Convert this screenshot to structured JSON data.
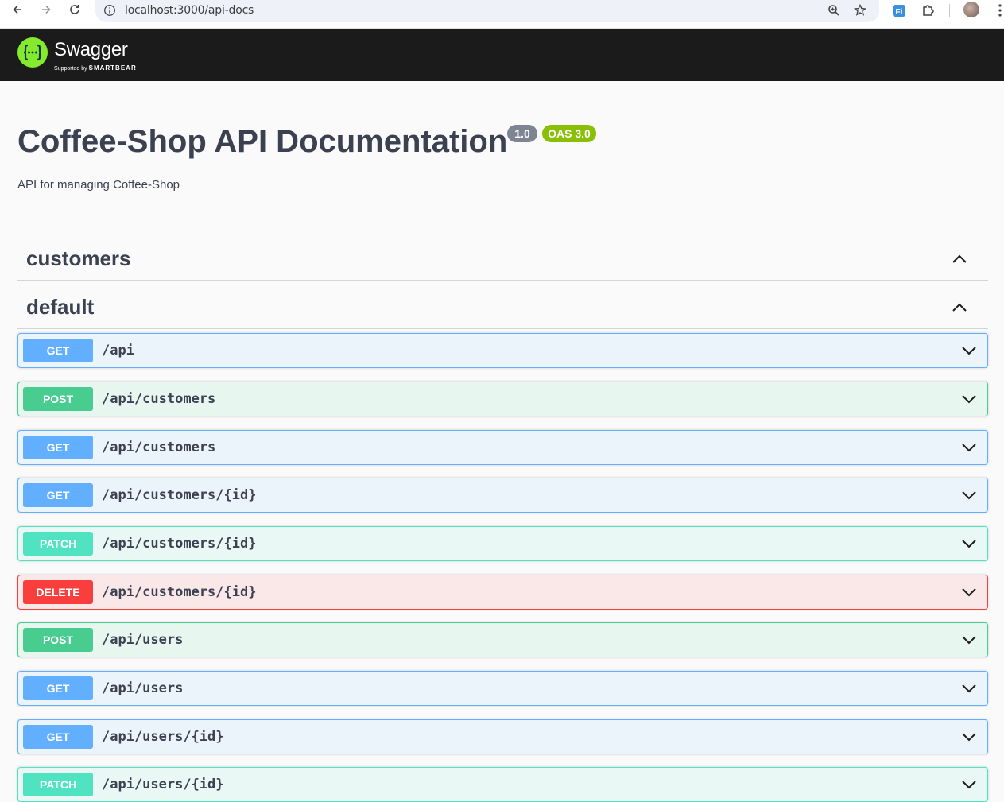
{
  "browser": {
    "url": "localhost:3000/api-docs"
  },
  "topbar": {
    "logo_text": "Swagger",
    "logo_sub_prefix": "Supported by",
    "logo_sub_brand": "SMARTBEAR"
  },
  "info": {
    "title": "Coffee-Shop API Documentation",
    "version": "1.0",
    "oas": "OAS 3.0",
    "description": "API for managing Coffee-Shop"
  },
  "tags": [
    {
      "name": "customers"
    },
    {
      "name": "default"
    }
  ],
  "operations": [
    {
      "method": "GET",
      "path": "/api"
    },
    {
      "method": "POST",
      "path": "/api/customers"
    },
    {
      "method": "GET",
      "path": "/api/customers"
    },
    {
      "method": "GET",
      "path": "/api/customers/{id}"
    },
    {
      "method": "PATCH",
      "path": "/api/customers/{id}"
    },
    {
      "method": "DELETE",
      "path": "/api/customers/{id}"
    },
    {
      "method": "POST",
      "path": "/api/users"
    },
    {
      "method": "GET",
      "path": "/api/users"
    },
    {
      "method": "GET",
      "path": "/api/users/{id}"
    },
    {
      "method": "PATCH",
      "path": "/api/users/{id}"
    }
  ],
  "colors": {
    "get": "#61affe",
    "post": "#49cc90",
    "patch": "#50e3c2",
    "delete": "#f93e3e",
    "topbar": "#1b1b1b",
    "swagger_green": "#85ea2d"
  }
}
